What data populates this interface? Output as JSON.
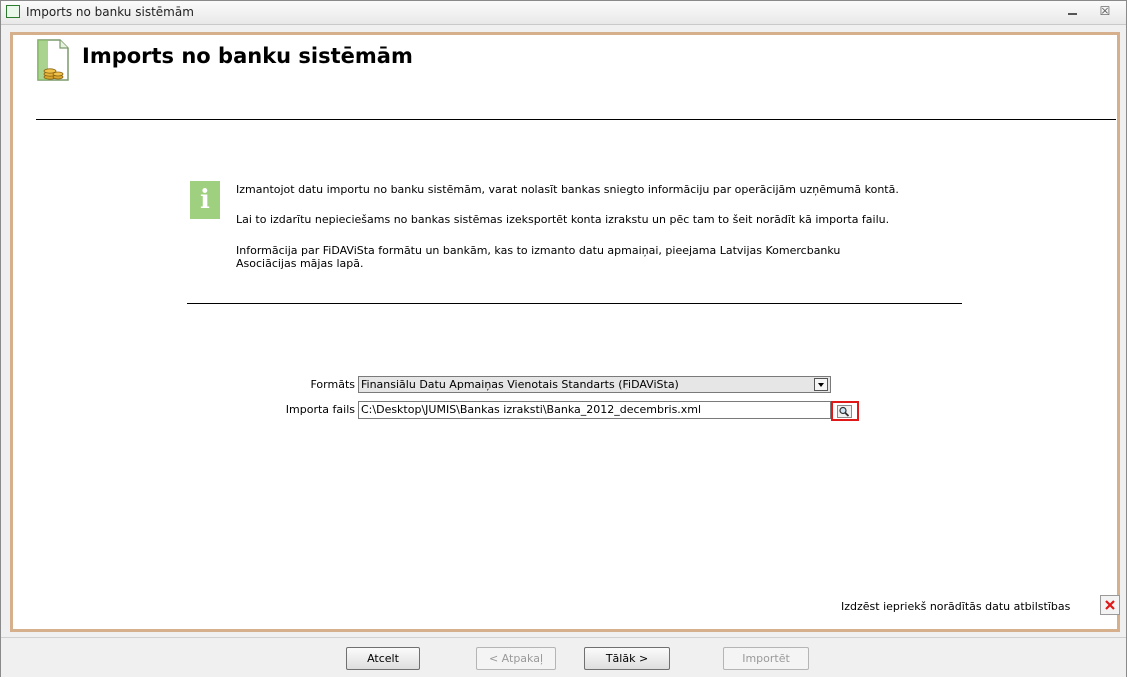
{
  "window": {
    "title": "Imports no banku sistēmām",
    "minimize_glyph": "▭",
    "close_glyph": "☒"
  },
  "header": {
    "title": "Imports no banku sistēmām",
    "icon": "document-coins-icon"
  },
  "info": {
    "icon": "info-icon",
    "icon_glyph": "i",
    "line1": "Izmantojot datu importu no banku sistēmām, varat nolasīt bankas sniegto informāciju par operācijām uzņēmumā kontā.",
    "line2": "Lai to izdarītu nepieciešams no bankas sistēmas izeksportēt konta izrakstu un pēc tam to šeit norādīt kā importa failu.",
    "line3a": "Informācija par FiDAViSta formātu un bankām, kas to izmanto datu apmaiņai, pieejama Latvijas Komercbanku",
    "line3b": "Asociācijas mājas lapā."
  },
  "form": {
    "format_label": "Formāts",
    "format_value": "Finansiālu Datu Apmaiņas Vienotais Standarts (FiDAViSta)",
    "file_label": "Importa fails",
    "file_value": "C:\\Desktop\\JUMIS\\Bankas izraksti\\Banka_2012_decembris.xml",
    "browse_icon": "magnifier-icon"
  },
  "clear": {
    "label": "Izdzēst iepriekš norādītās datu atbilstības",
    "icon": "red-x-icon"
  },
  "buttons": {
    "cancel": "Atcelt",
    "back": "< Atpakaļ",
    "next": "Tālāk >",
    "import": "Importēt"
  },
  "colors": {
    "frame": "#d6b08c",
    "info_icon_bg": "#9ed07f",
    "browse_highlight": "#e01818"
  }
}
